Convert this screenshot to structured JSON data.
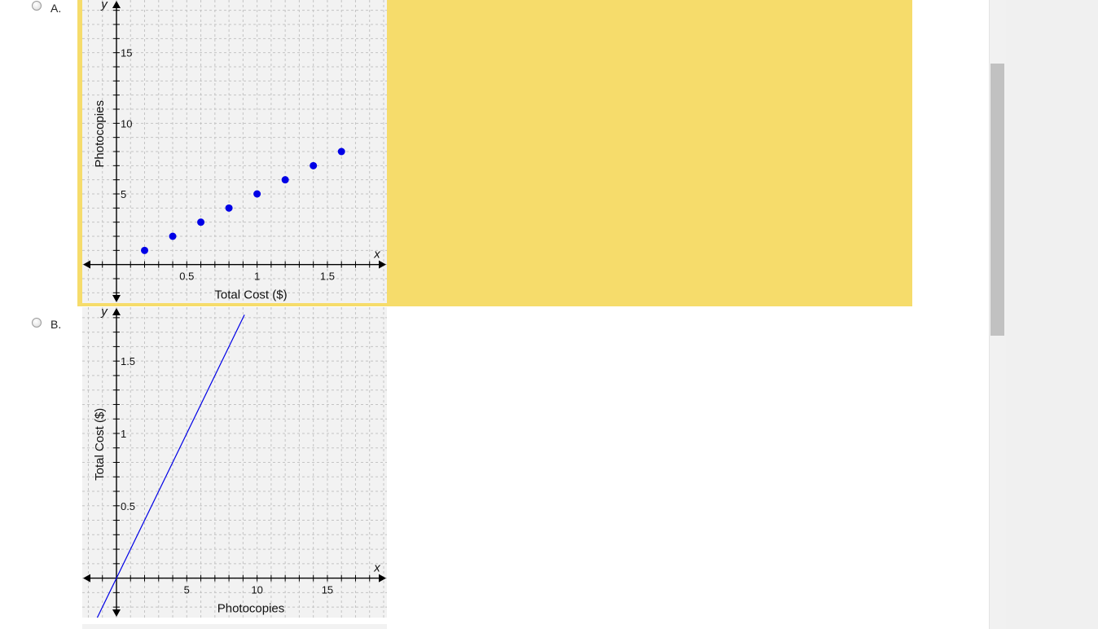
{
  "choices": [
    {
      "label": "A.",
      "selected": false
    },
    {
      "label": "B.",
      "selected": false
    }
  ],
  "colors": {
    "highlight": "#f6dc6b",
    "series": "#0000e6"
  },
  "chart_data": [
    {
      "type": "scatter",
      "xlabel": "Total Cost ($)",
      "ylabel": "Photocopies",
      "x_axis_var": "x",
      "y_axis_var": "y",
      "xlim": [
        -0.22,
        1.9
      ],
      "ylim": [
        -2.5,
        18.5
      ],
      "x_ticks": [
        0.5,
        1,
        1.5
      ],
      "x_tick_labels": [
        "0.5",
        "1",
        "1.5"
      ],
      "y_ticks": [
        5,
        10,
        15
      ],
      "y_tick_labels": [
        "5",
        "10",
        "15"
      ],
      "x_minor_step": 0.1,
      "y_minor_step": 1,
      "grid": true,
      "x": [
        0.2,
        0.4,
        0.6,
        0.8,
        1.0,
        1.2,
        1.4,
        1.6
      ],
      "y": [
        1,
        2,
        3,
        4,
        5,
        6,
        7,
        8
      ]
    },
    {
      "type": "line",
      "xlabel": "Photocopies",
      "ylabel": "Total Cost ($)",
      "x_axis_var": "x",
      "y_axis_var": "y",
      "xlim": [
        -2.2,
        19
      ],
      "ylim": [
        -0.25,
        1.85
      ],
      "x_ticks": [
        5,
        10,
        15
      ],
      "x_tick_labels": [
        "5",
        "10",
        "15"
      ],
      "y_ticks": [
        0.5,
        1,
        1.5
      ],
      "y_tick_labels": [
        "0.5",
        "1",
        "1.5"
      ],
      "x_minor_step": 1,
      "y_minor_step": 0.1,
      "grid": true,
      "x": [
        -1.4,
        9.1
      ],
      "y": [
        -0.28,
        1.82
      ]
    }
  ]
}
